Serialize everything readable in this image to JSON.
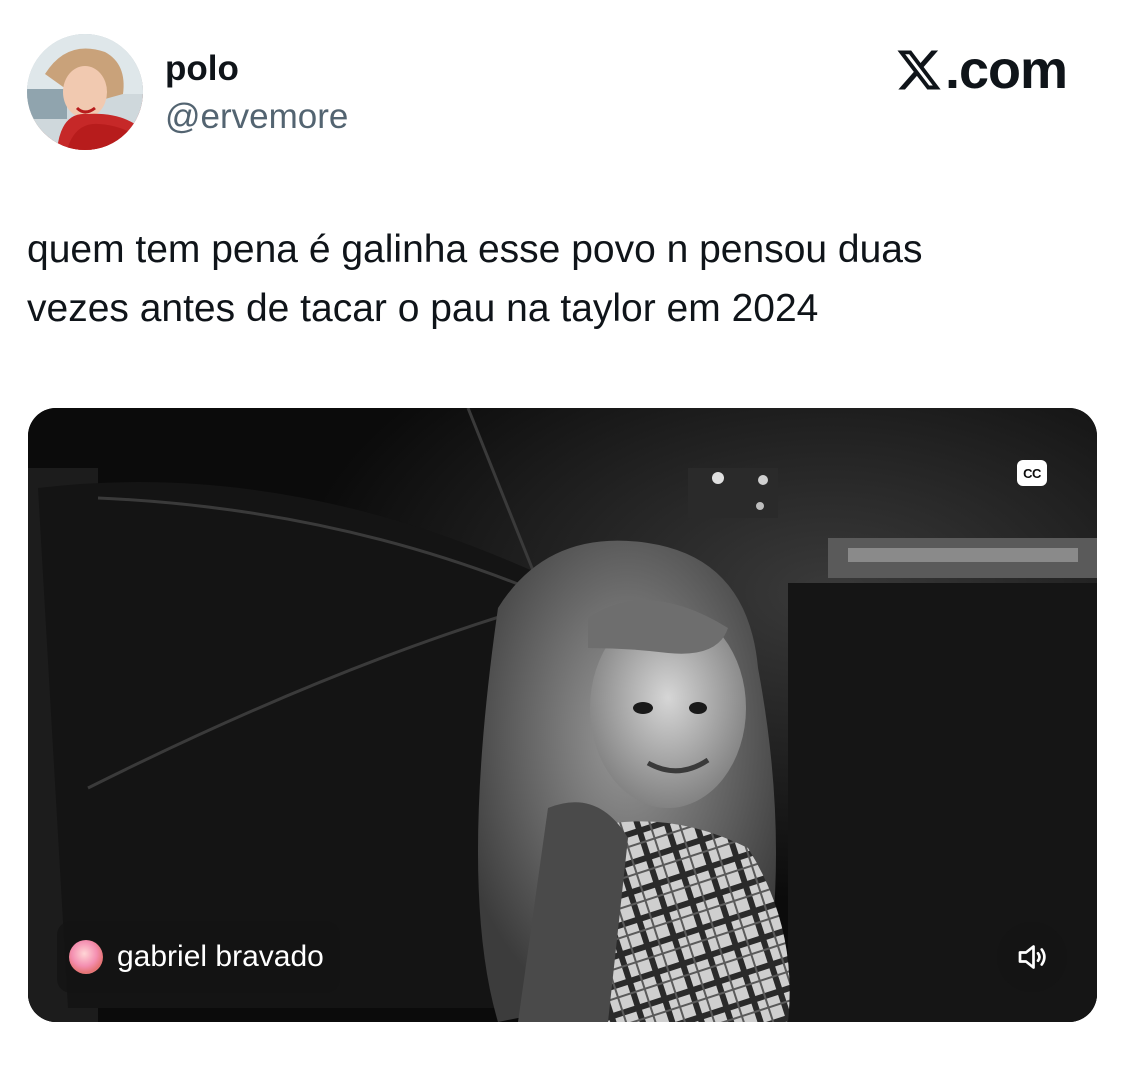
{
  "author": {
    "display_name": "polo",
    "handle": "@ervemore",
    "avatar_icon": "profile-photo"
  },
  "brand": {
    "text": ".com",
    "logo_icon": "x-logo-icon"
  },
  "tweet": {
    "text": "quem tem pena é galinha esse povo n pensou duas\nvezes antes de tacar o pau na taylor em 2024"
  },
  "media": {
    "type": "video",
    "cc_label": "CC",
    "attribution_name": "gabriel bravado",
    "volume_icon": "volume-icon"
  },
  "colors": {
    "text_primary": "#0f1419",
    "text_secondary": "#536471",
    "overlay_bg": "#141414"
  }
}
